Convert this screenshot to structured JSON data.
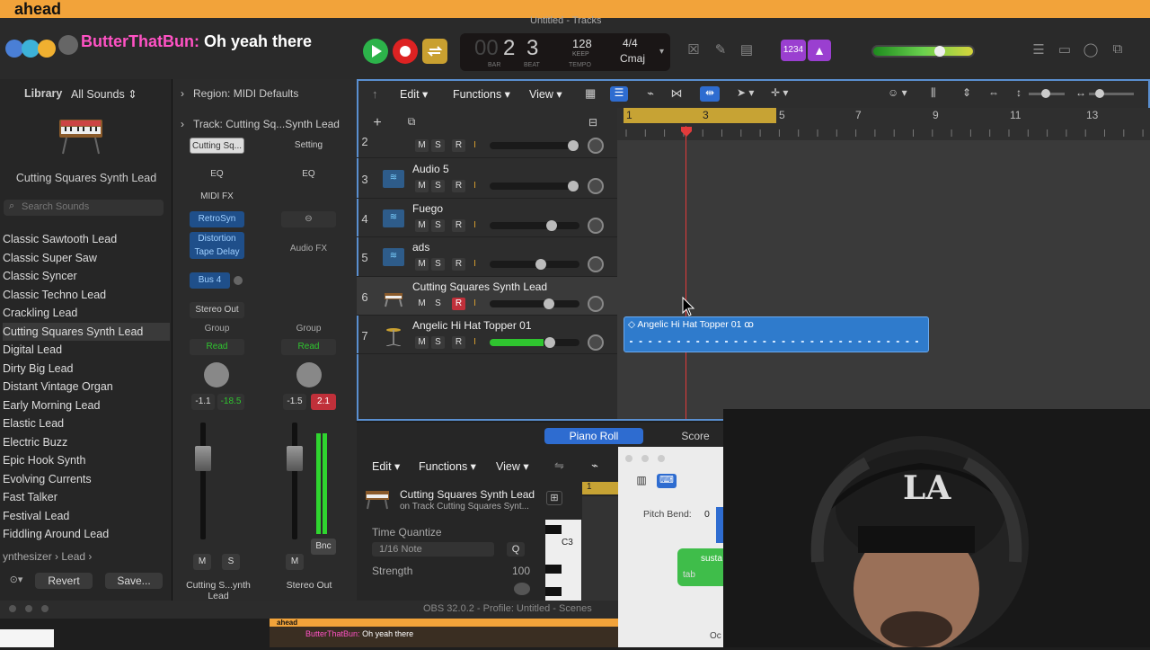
{
  "caption": "ahead",
  "window_title": "Untitled - Tracks",
  "chat": {
    "user": "ButterThatBun:",
    "message": "Oh yeah there"
  },
  "lcd": {
    "bar_dim": "00",
    "bar": "2",
    "beat": "3",
    "bar_label": "BAR",
    "beat_label": "BEAT",
    "tempo": "128",
    "keep": "KEEP",
    "tempo_label": "TEMPO",
    "timesig": "4/4",
    "key": "Cmaj"
  },
  "count_in": "1234",
  "library": {
    "title": "Library",
    "sounds_dropdown": "All Sounds",
    "patch_name": "Cutting Squares Synth Lead",
    "search_placeholder": "Search Sounds",
    "items": [
      "Classic Sawtooth Lead",
      "Classic Super Saw",
      "Classic Syncer",
      "Classic Techno Lead",
      "Crackling Lead",
      "Cutting Squares Synth Lead",
      "Digital Lead",
      "Dirty Big Lead",
      "Distant Vintage Organ",
      "Early Morning Lead",
      "Elastic Lead",
      "Electric Buzz",
      "Epic Hook Synth",
      "Evolving Currents",
      "Fast Talker",
      "Festival Lead",
      "Fiddling Around Lead"
    ],
    "breadcrumb": "ynthesizer",
    "breadcrumb2": "Lead",
    "revert": "Revert",
    "save": "Save..."
  },
  "inspector": {
    "region": "Region: MIDI Defaults",
    "track": "Track:  Cutting Sq...Synth Lead",
    "ch1": {
      "name_top": "Cutting Sq...",
      "eq": "EQ",
      "midifx": "MIDI FX",
      "inst": "RetroSyn",
      "fx1": "Distortion",
      "fx2": "Tape Delay",
      "send": "Bus 4",
      "out": "Stereo Out",
      "group": "Group",
      "auto": "Read",
      "val1": "-1.1",
      "val2": "-18.5",
      "m": "M",
      "s": "S",
      "name": "Cutting S...ynth Lead"
    },
    "ch2": {
      "setting": "Setting",
      "eq": "EQ",
      "audiofx": "Audio FX",
      "group": "Group",
      "auto": "Read",
      "val1": "-1.5",
      "val2": "2.1",
      "bnc": "Bnc",
      "m": "M",
      "name": "Stereo Out"
    }
  },
  "menu": {
    "edit": "Edit",
    "functions": "Functions",
    "view": "View"
  },
  "tracks": [
    {
      "num": "2",
      "name": ""
    },
    {
      "num": "3",
      "name": "Audio 5"
    },
    {
      "num": "4",
      "name": "Fuego"
    },
    {
      "num": "5",
      "name": "ads"
    },
    {
      "num": "6",
      "name": "Cutting Squares Synth Lead"
    },
    {
      "num": "7",
      "name": "Angelic Hi Hat Topper 01"
    }
  ],
  "msr": {
    "m": "M",
    "s": "S",
    "r": "R",
    "i": "I"
  },
  "ruler": [
    "1",
    "3",
    "5",
    "7",
    "9",
    "11",
    "13"
  ],
  "region_name": "Angelic Hi Hat Topper 01",
  "bottom": {
    "tab1": "Piano Roll",
    "tab2": "Score",
    "edit": "Edit",
    "functions": "Functions",
    "view": "View",
    "track_name": "Cutting Squares Synth Lead",
    "track_sub": "on Track Cutting Squares Synt...",
    "tq": "Time Quantize",
    "tq_val": "1/16 Note",
    "q": "Q",
    "strength": "Strength",
    "strength_val": "100",
    "c3": "C3",
    "bar1": "1"
  },
  "smallwin": {
    "pitch_bend": "Pitch Bend:",
    "pb_val": "0",
    "sust": "susta",
    "tab": "tab",
    "oc": "Oc"
  },
  "obs": "OBS 32.0.2 - Profile: Untitled - Scenes",
  "obs_thumb": {
    "caption": "ahead",
    "chat_user": "ButterThatBun:",
    "chat_msg": "Oh yeah there"
  }
}
